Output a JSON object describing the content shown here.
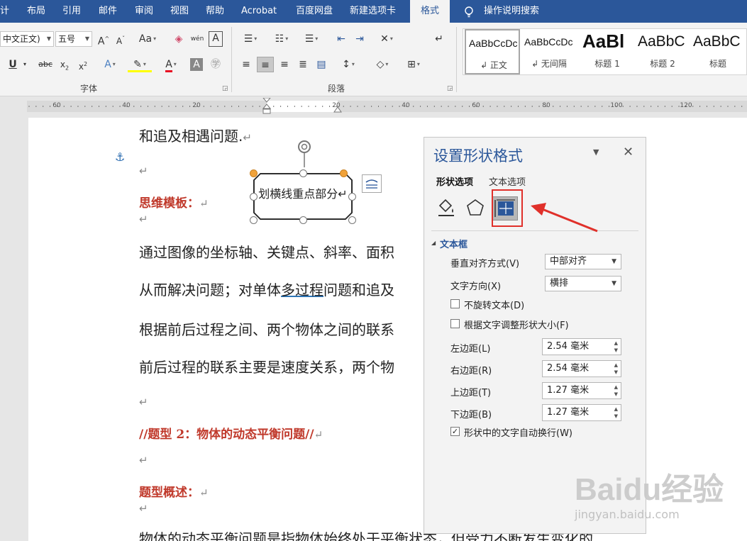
{
  "tabs": [
    "计",
    "布局",
    "引用",
    "邮件",
    "审阅",
    "视图",
    "帮助",
    "Acrobat",
    "百度网盘",
    "新建选项卡",
    "格式"
  ],
  "active_tab": "格式",
  "tell_me": "操作说明搜索",
  "ribbon": {
    "font_name": "中文正文)",
    "font_size": "五号",
    "font_group_label": "字体",
    "paragraph_group_label": "段落",
    "styles": [
      {
        "preview": "AaBbCcDc",
        "name": "↲ 正文"
      },
      {
        "preview": "AaBbCcDc",
        "name": "↲ 无间隔"
      },
      {
        "preview": "AaBl",
        "name": "标题 1"
      },
      {
        "preview": "AaBbC",
        "name": "标题 2"
      },
      {
        "preview": "AaBbC",
        "name": "标题"
      }
    ]
  },
  "ruler_labels": [
    "60",
    "40",
    "20",
    "20",
    "40",
    "60",
    "80",
    "100",
    "120"
  ],
  "document": {
    "line1": "和追及相遇问题.",
    "heading_thinking": "思维模板：",
    "para1": "通过图像的坐标轴、关键点、斜率、面积",
    "para2a": "从而解决问题；对单体",
    "para2b": "多过程",
    "para2c": "问题和追及",
    "para3": "根据前后过程之间、两个物体之间的联系",
    "para4": "前后过程的联系主要是速度关系，两个物",
    "heading_type2": "//题型 2：物体的动态平衡问题//",
    "heading_overview": "题型概述：",
    "para5": "物体的动态平衡问题是指物体始终处于平衡状态，但受力不断发生变化的",
    "pilcrow": "↵"
  },
  "shape_text": "划横线重点部分↵",
  "pane": {
    "title": "设置形状格式",
    "tab_shape": "形状选项",
    "tab_text": "文本选项",
    "section": "文本框",
    "valign_label": "垂直对齐方式(V)",
    "valign_value": "中部对齐",
    "direction_label": "文字方向(X)",
    "direction_value": "横排",
    "no_rotate": "不旋转文本(D)",
    "autofit": "根据文字调整形状大小(F)",
    "left_label": "左边距(L)",
    "left_value": "2.54 毫米",
    "right_label": "右边距(R)",
    "right_value": "2.54 毫米",
    "top_label": "上边距(T)",
    "top_value": "1.27 毫米",
    "bottom_label": "下边距(B)",
    "bottom_value": "1.27 毫米",
    "wrap": "形状中的文字自动换行(W)"
  },
  "watermark": {
    "logo": "Baidu经验",
    "url": "jingyan.baidu.com"
  },
  "colors": {
    "ribbon_blue": "#2b579a",
    "heading_red": "#c0392b",
    "highlight_red": "#e0302a"
  }
}
